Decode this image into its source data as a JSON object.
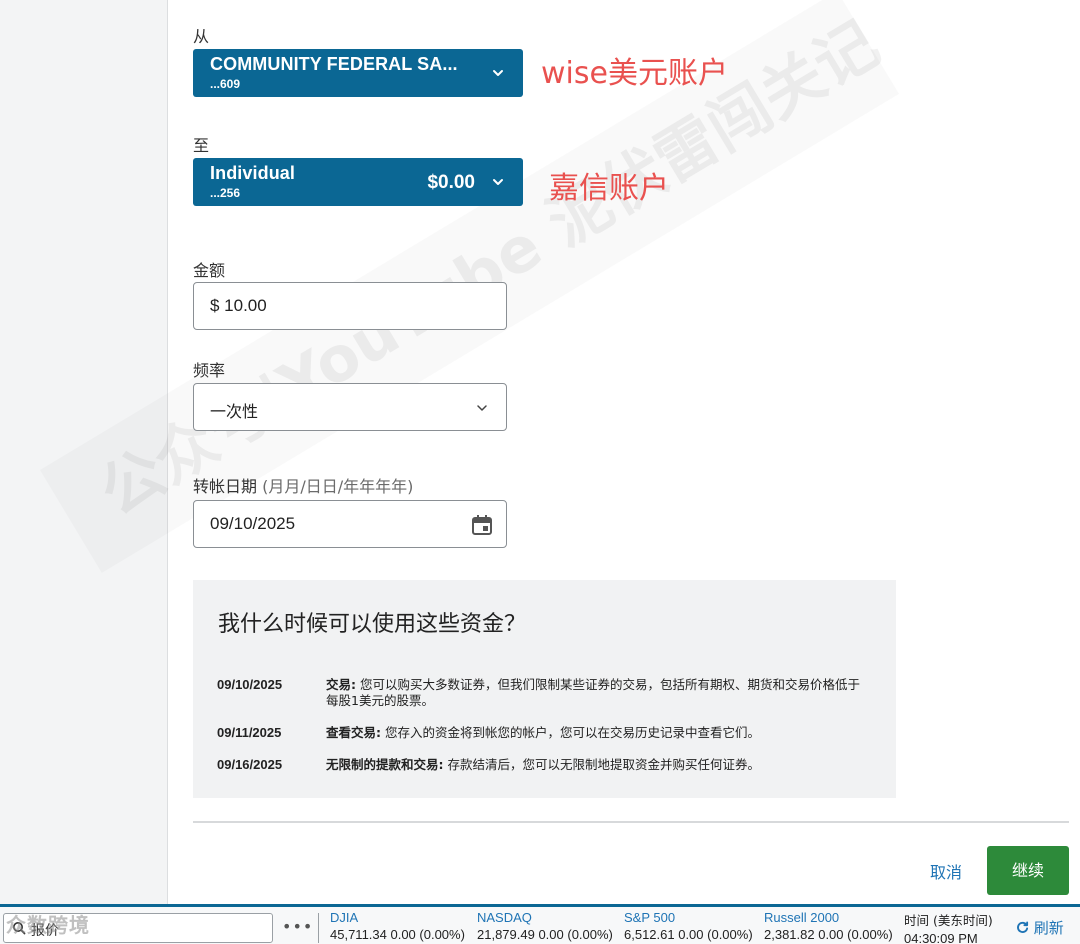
{
  "form": {
    "from_label": "从",
    "from_account": {
      "name": "COMMUNITY FEDERAL SA...",
      "number": "...609"
    },
    "from_annotation": "wise美元账户",
    "to_label": "至",
    "to_account": {
      "name": "Individual",
      "number": "...256",
      "balance": "$0.00"
    },
    "to_annotation": "嘉信账户",
    "amount_label": "金额",
    "amount_value": "$ 10.00",
    "frequency_label": "频率",
    "frequency_value": "一次性",
    "date_label": "转帐日期",
    "date_hint": "(月月/日日/年年年年)",
    "date_value": "09/10/2025"
  },
  "info": {
    "title": "我什么时候可以使用这些资金？",
    "rows": [
      {
        "date": "09/10/2025",
        "heading": "交易:",
        "text": "您可以购买大多数证券，但我们限制某些证券的交易，包括所有期权、期货和交易价格低于每股1美元的股票。"
      },
      {
        "date": "09/11/2025",
        "heading": "查看交易:",
        "text": "您存入的资金将到帐您的帐户，您可以在交易历史记录中查看它们。"
      },
      {
        "date": "09/16/2025",
        "heading": "无限制的提款和交易:",
        "text": "存款结清后，您可以无限制地提取资金并购买任何证券。"
      }
    ]
  },
  "actions": {
    "cancel": "取消",
    "continue": "继续"
  },
  "ticker": {
    "search_placeholder": "报价",
    "more": "•••",
    "indices": [
      {
        "name": "DJIA",
        "value": "45,711.34 0.00 (0.00%)"
      },
      {
        "name": "NASDAQ",
        "value": "21,879.49 0.00 (0.00%)"
      },
      {
        "name": "S&P 500",
        "value": "6,512.61 0.00 (0.00%)"
      },
      {
        "name": "Russell 2000",
        "value": "2,381.82 0.00 (0.00%)"
      }
    ],
    "time_label": "时间 (美东时间)",
    "time_value": "04:30:09 PM",
    "refresh": "刷新"
  },
  "watermark": {
    "text": "公众号|YouTube 泥伏雷闯关记",
    "logo": "众数跨境"
  },
  "colors": {
    "account_blue": "#0b6794",
    "annotation_red": "#e9514f",
    "continue_green": "#2d8a3a",
    "link_blue": "#1f74b5"
  },
  "icons": {
    "account_chevron": "chevron-down-icon",
    "calendar": "calendar-icon",
    "search": "search-icon",
    "refresh": "refresh-icon"
  }
}
